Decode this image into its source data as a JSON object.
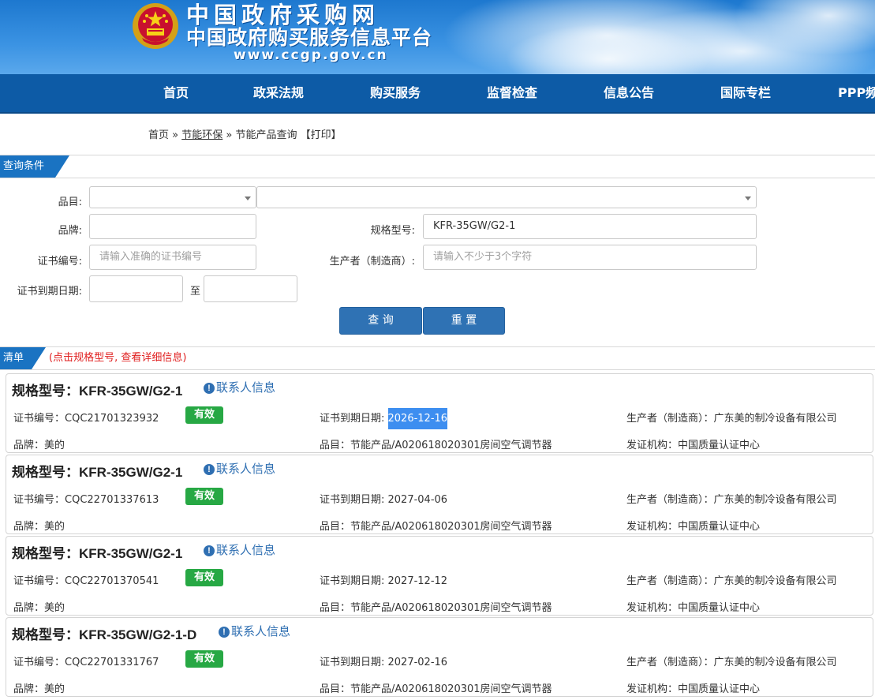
{
  "header": {
    "title": "中国政府采购网",
    "subtitle": "中国政府购买服务信息平台",
    "url": "www.ccgp.gov.cn"
  },
  "nav": [
    "首页",
    "政采法规",
    "购买服务",
    "监督检查",
    "信息公告",
    "国际专栏",
    "PPP频"
  ],
  "breadcrumb": {
    "home": "首页",
    "sep1": " » ",
    "category": "节能环保",
    "sep2": " » ",
    "current": "节能产品查询",
    "print": "【打印】"
  },
  "query": {
    "section_title": "查询条件",
    "category_label": "品目:",
    "brand_label": "品牌:",
    "model_label": "规格型号:",
    "model_value": "KFR-35GW/G2-1",
    "cert_label": "证书编号:",
    "cert_placeholder": "请输入准确的证书编号",
    "maker_label": "生产者（制造商）:",
    "maker_placeholder": "请输入不少于3个字符",
    "expiry_label": "证书到期日期:",
    "to_label": "至",
    "search_button": "查 询",
    "reset_button": "重 置"
  },
  "list": {
    "section_title": "清单",
    "hint": "(点击规格型号, 查看详细信息)",
    "model_prefix": "规格型号：",
    "contact_label": "联系人信息",
    "cert_prefix": "证书编号：",
    "expiry_prefix": "证书到期日期: ",
    "maker_prefix": "生产者（制造商）：",
    "brand_prefix": "品牌：",
    "category_prefix": "品目：",
    "issuer_prefix": "发证机构：",
    "items": [
      {
        "model": "KFR-35GW/G2-1",
        "cert_no": "CQC21701323932",
        "status": "有效",
        "expiry": "2026-12-16",
        "maker": "广东美的制冷设备有限公司",
        "brand": "美的",
        "category": "节能产品/A020618020301房间空气调节器",
        "issuer": "中国质量认证中心"
      },
      {
        "model": "KFR-35GW/G2-1",
        "cert_no": "CQC22701337613",
        "status": "有效",
        "expiry": "2027-04-06",
        "maker": "广东美的制冷设备有限公司",
        "brand": "美的",
        "category": "节能产品/A020618020301房间空气调节器",
        "issuer": "中国质量认证中心"
      },
      {
        "model": "KFR-35GW/G2-1",
        "cert_no": "CQC22701370541",
        "status": "有效",
        "expiry": "2027-12-12",
        "maker": "广东美的制冷设备有限公司",
        "brand": "美的",
        "category": "节能产品/A020618020301房间空气调节器",
        "issuer": "中国质量认证中心"
      },
      {
        "model": "KFR-35GW/G2-1-D",
        "cert_no": "CQC22701331767",
        "status": "有效",
        "expiry": "2027-02-16",
        "maker": "广东美的制冷设备有限公司",
        "brand": "美的",
        "category": "节能产品/A020618020301房间空气调节器",
        "issuer": "中国质量认证中心"
      }
    ]
  },
  "colors": {
    "nav_bg": "#0d5ba6",
    "section_tab": "#1a73c2",
    "badge_green": "#27a844",
    "link_blue": "#2f6fb2",
    "selection": "#3d8ef0"
  }
}
